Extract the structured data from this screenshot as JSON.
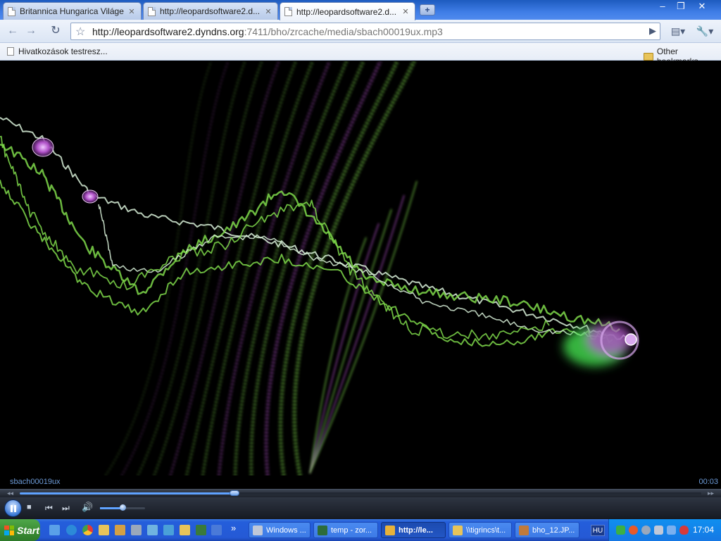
{
  "browser": {
    "tabs": [
      {
        "title": "Britannica Hungarica Világe...",
        "active": false
      },
      {
        "title": "http://leopardsoftware2.d...",
        "active": false
      },
      {
        "title": "http://leopardsoftware2.d...",
        "active": true
      }
    ],
    "new_tab_icon": "plus-icon",
    "window_controls": {
      "minimize": "–",
      "restore": "❐",
      "close": "✕"
    },
    "url_host": "http://leopardsoftware2.dyndns.org",
    "url_rest": ":7411/bho/zrcache/media/sbach00019ux.mp3",
    "bookmarks": {
      "items": [
        {
          "label": "Hivatkozások testresz..."
        }
      ],
      "other_label": "Other bookmarks"
    }
  },
  "player": {
    "media_title": "sbach00019ux",
    "elapsed": "00:03",
    "seek_fraction": 0.315,
    "volume_fraction": 0.5
  },
  "taskbar": {
    "start_label": "Start",
    "buttons": [
      {
        "label": "Windows ...",
        "active": false,
        "color": "#c0c8d8"
      },
      {
        "label": "temp - zor...",
        "active": false,
        "color": "#2d6c3a"
      },
      {
        "label": "http://le...",
        "active": true,
        "color": "#e8b23a"
      },
      {
        "label": "\\\\tigrincs\\t...",
        "active": false,
        "color": "#e8c45a"
      },
      {
        "label": "bho_12.JP...",
        "active": false,
        "color": "#c07a3a"
      }
    ],
    "language": "HU",
    "clock": "17:04"
  },
  "colors": {
    "viz_green": "#7ed84a",
    "viz_purple": "#b050c8",
    "viz_white": "#d8f0d8",
    "player_accent": "#5fa2ff"
  }
}
